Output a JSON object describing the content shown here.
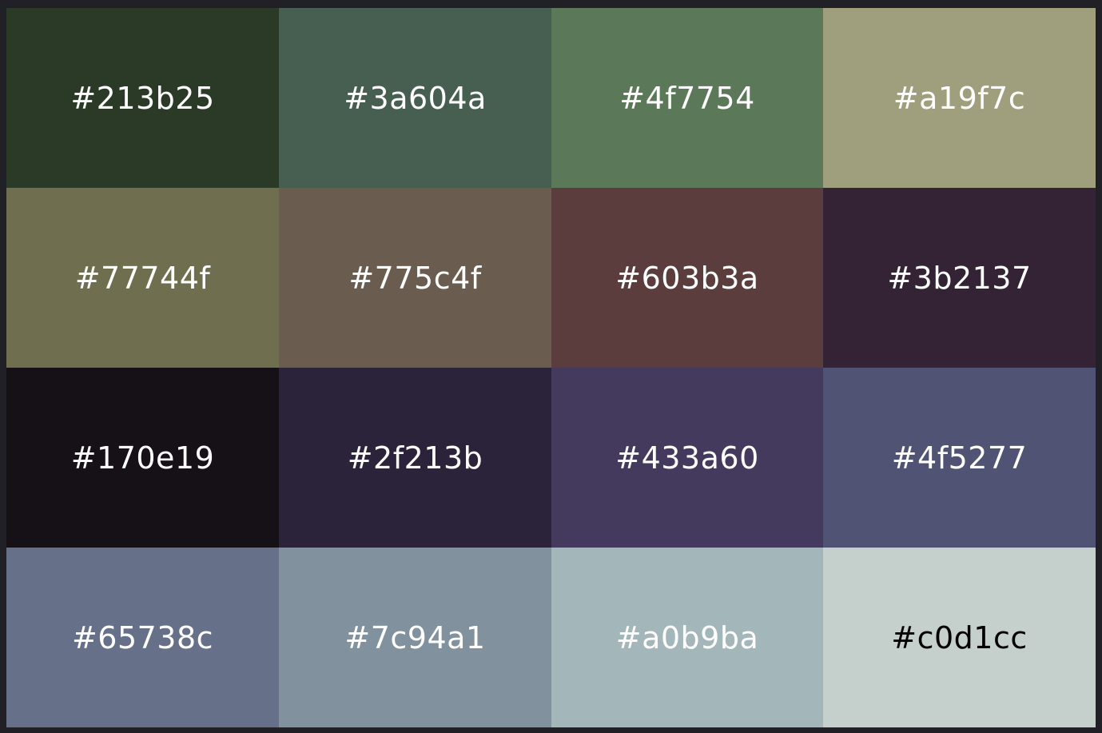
{
  "palette": {
    "swatches": [
      {
        "label": "#213b25",
        "bg": "#2a3a27",
        "text_color": "#ffffff"
      },
      {
        "label": "#3a604a",
        "bg": "#465f50",
        "text_color": "#ffffff"
      },
      {
        "label": "#4f7754",
        "bg": "#5b7858",
        "text_color": "#ffffff"
      },
      {
        "label": "#a19f7c",
        "bg": "#9f9f7e",
        "text_color": "#ffffff"
      },
      {
        "label": "#77744f",
        "bg": "#6f6f4f",
        "text_color": "#ffffff"
      },
      {
        "label": "#775c4f",
        "bg": "#6b5c50",
        "text_color": "#ffffff"
      },
      {
        "label": "#603b3a",
        "bg": "#5a3d3c",
        "text_color": "#ffffff"
      },
      {
        "label": "#3b2137",
        "bg": "#332335",
        "text_color": "#ffffff"
      },
      {
        "label": "#170e19",
        "bg": "#151117",
        "text_color": "#ffffff"
      },
      {
        "label": "#2f213b",
        "bg": "#2b233a",
        "text_color": "#ffffff"
      },
      {
        "label": "#433a60",
        "bg": "#433a5e",
        "text_color": "#ffffff"
      },
      {
        "label": "#4f5277",
        "bg": "#505374",
        "text_color": "#ffffff"
      },
      {
        "label": "#65738c",
        "bg": "#677089",
        "text_color": "#ffffff"
      },
      {
        "label": "#7c94a1",
        "bg": "#81919e",
        "text_color": "#ffffff"
      },
      {
        "label": "#a0b9ba",
        "bg": "#a3b6b9",
        "text_color": "#ffffff"
      },
      {
        "label": "#c0d1cc",
        "bg": "#c5cfcb",
        "text_color": "#000000"
      }
    ]
  }
}
